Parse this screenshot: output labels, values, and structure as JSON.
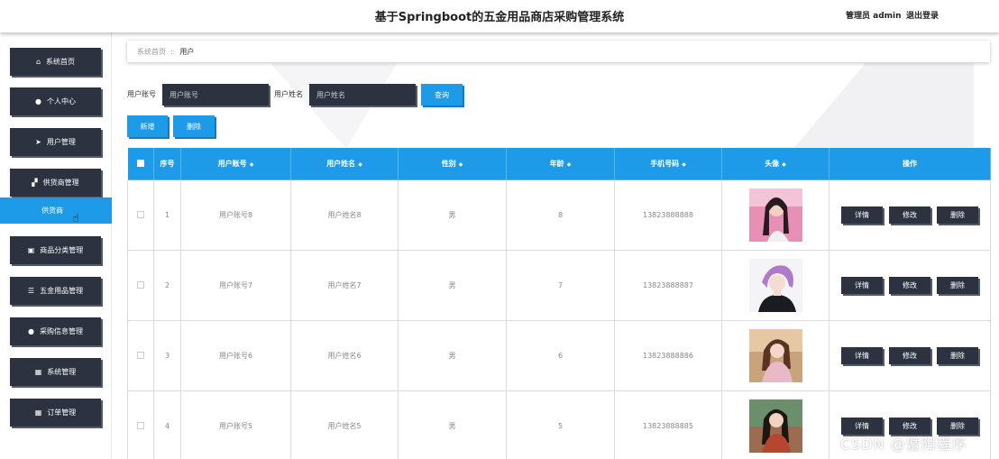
{
  "header": {
    "title": "基于Springboot的五金用品商店采购管理系统",
    "admin": "管理员 admin",
    "logout": "退出登录"
  },
  "sidebar": {
    "items": [
      {
        "label": "系统首页",
        "icon": "home-icon"
      },
      {
        "label": "个人中心",
        "icon": "user-icon"
      },
      {
        "label": "用户管理",
        "icon": "paper-plane-icon"
      },
      {
        "label": "供货商管理",
        "icon": "thumbs-up-icon"
      },
      {
        "label": "商品分类管理",
        "icon": "briefcase-icon"
      },
      {
        "label": "五金用品管理",
        "icon": "list-icon"
      },
      {
        "label": "采购信息管理",
        "icon": "user-icon"
      },
      {
        "label": "系统管理",
        "icon": "grid-icon"
      },
      {
        "label": "订单管理",
        "icon": "grid-icon"
      }
    ],
    "active_sub": "供货商"
  },
  "breadcrumb": {
    "home": "系统首页",
    "separator": "::",
    "current": "用户"
  },
  "search": {
    "account_label": "用户账号",
    "account_placeholder": "用户账号",
    "name_label": "用户姓名",
    "name_placeholder": "用户姓名",
    "query_button": "查询"
  },
  "toolbar": {
    "add_button": "新增",
    "delete_button": "删除"
  },
  "table": {
    "headers": [
      "序号",
      "用户账号",
      "用户姓名",
      "性别",
      "年龄",
      "手机号码",
      "头像",
      "操作"
    ],
    "rows": [
      {
        "index": "1",
        "account": "用户账号8",
        "name": "用户姓名8",
        "gender": "男",
        "age": "8",
        "phone": "13823888888"
      },
      {
        "index": "2",
        "account": "用户账号7",
        "name": "用户姓名7",
        "gender": "男",
        "age": "7",
        "phone": "13823888887"
      },
      {
        "index": "3",
        "account": "用户账号6",
        "name": "用户姓名6",
        "gender": "男",
        "age": "6",
        "phone": "13823888886"
      },
      {
        "index": "4",
        "account": "用户账号5",
        "name": "用户姓名5",
        "gender": "男",
        "age": "5",
        "phone": "13823888885"
      }
    ],
    "actions": {
      "detail": "详情",
      "edit": "修改",
      "delete": "删除"
    }
  },
  "watermark": "CSDN @暨阳程序",
  "colors": {
    "accent": "#1e9be8",
    "dark_button": "#2c3240"
  }
}
